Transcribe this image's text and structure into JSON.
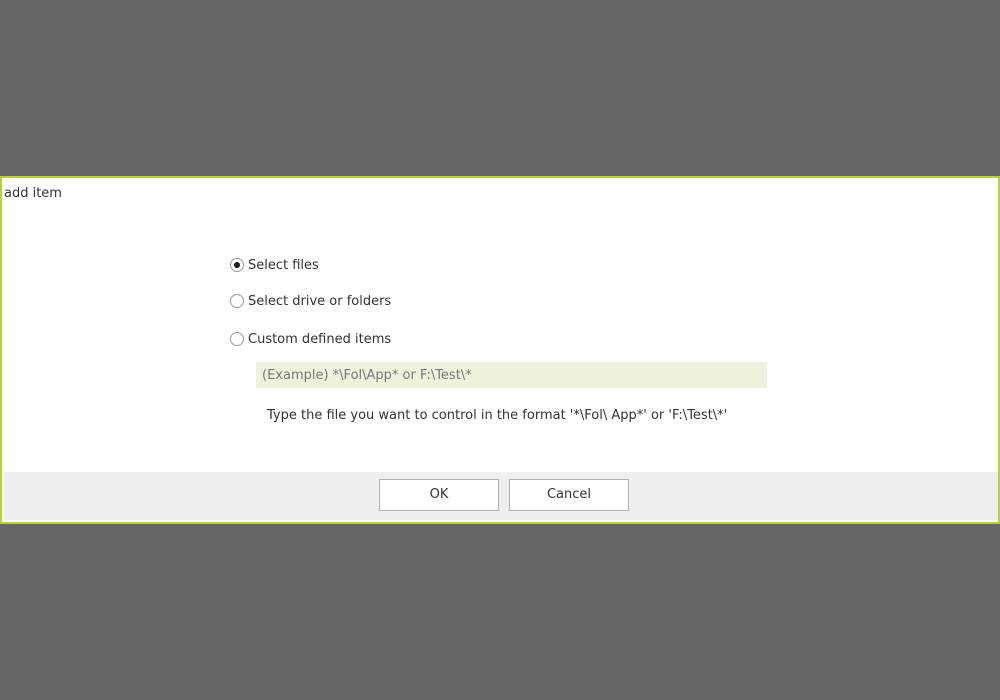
{
  "dialog": {
    "title": "add item",
    "accent_color": "#b7d23a"
  },
  "options": [
    {
      "label": "Select files",
      "checked": true
    },
    {
      "label": "Select drive or folders",
      "checked": false
    },
    {
      "label": "Custom defined items",
      "checked": false
    }
  ],
  "custom_input": {
    "value": "",
    "placeholder": "(Example) *\\Fol\\App* or F:\\Test\\*"
  },
  "hint": "Type the file you want to control in the format '*\\Fol\\ App*' or 'F:\\Test\\*'",
  "buttons": {
    "ok_label": "OK",
    "cancel_label": "Cancel"
  }
}
